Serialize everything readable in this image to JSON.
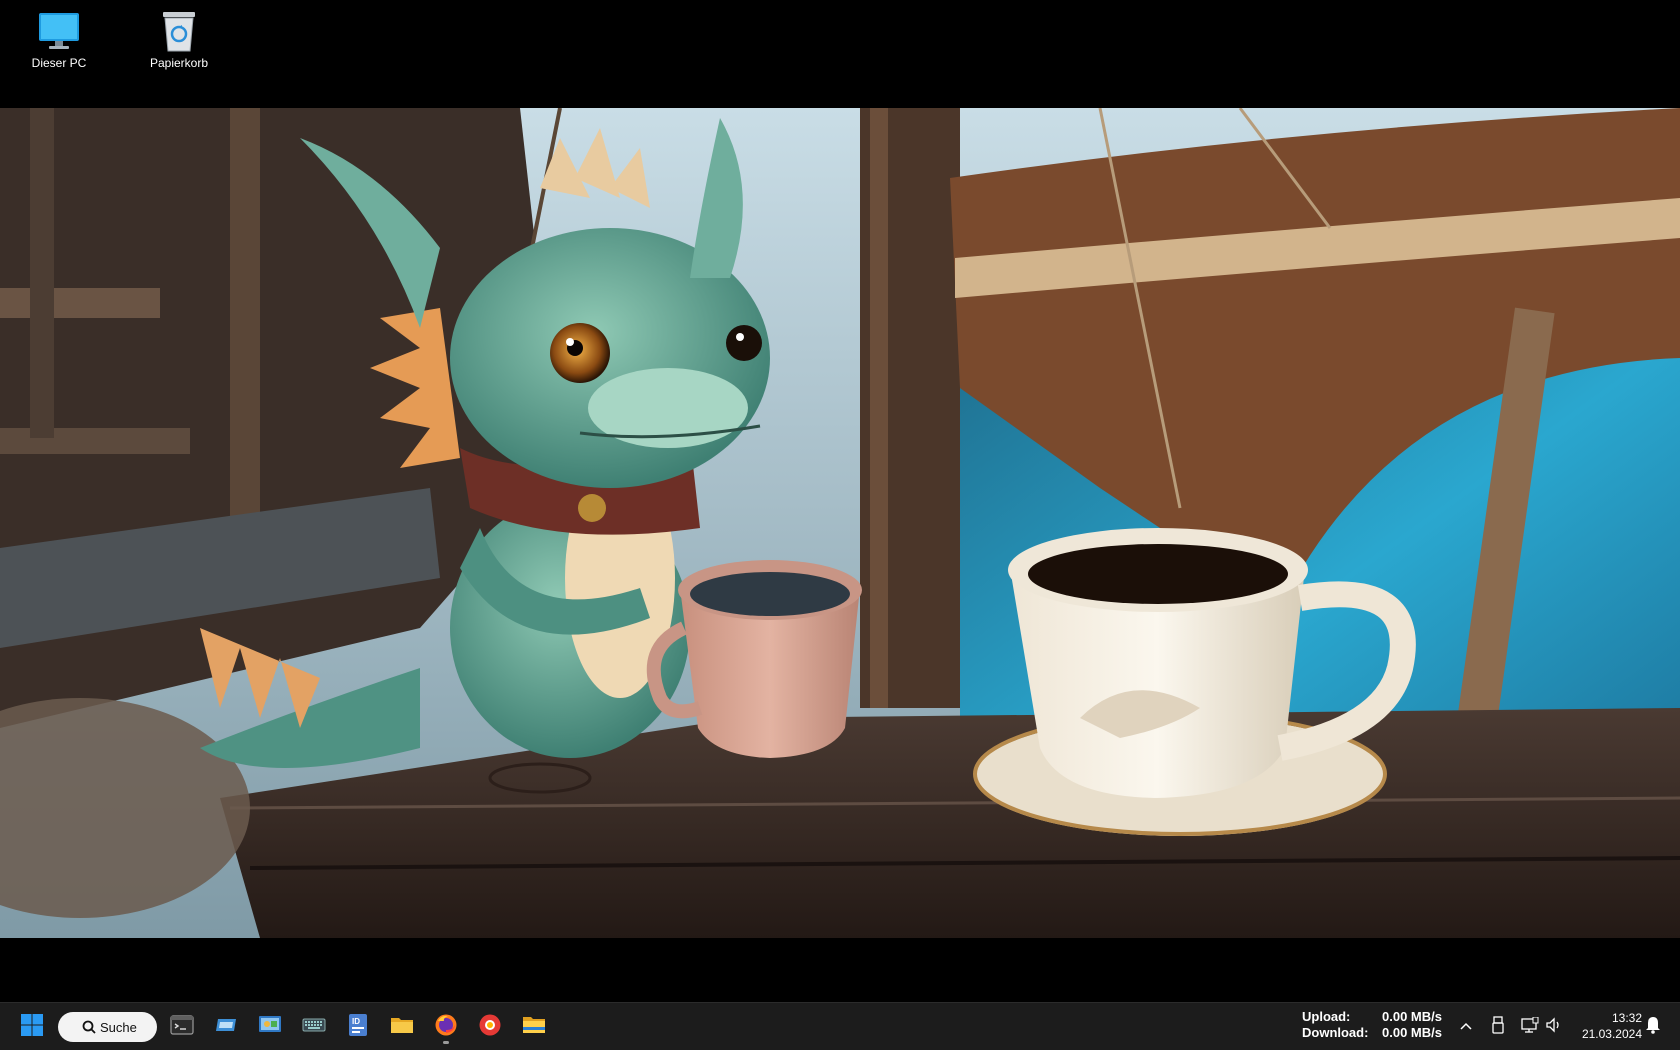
{
  "desktop": {
    "icons": [
      {
        "label": "Dieser PC",
        "icon": "computer-icon"
      },
      {
        "label": "Papierkorb",
        "icon": "recycle-bin-icon"
      }
    ],
    "wallpaper": "dragon-with-coffee-on-ship-deck"
  },
  "taskbar": {
    "start_icon": "windows-start-icon",
    "search_placeholder": "Suche",
    "apps": [
      {
        "name": "terminal",
        "icon": "terminal-icon"
      },
      {
        "name": "tablet-mode",
        "icon": "window-icon"
      },
      {
        "name": "control-panel",
        "icon": "control-panel-icon"
      },
      {
        "name": "on-screen-keyboard",
        "icon": "keyboard-icon"
      },
      {
        "name": "id-card-app",
        "icon": "id-card-icon"
      },
      {
        "name": "folder",
        "icon": "folder-icon"
      },
      {
        "name": "firefox",
        "icon": "firefox-icon",
        "active": true
      },
      {
        "name": "record-app",
        "icon": "record-icon"
      },
      {
        "name": "file-explorer",
        "icon": "file-explorer-icon"
      }
    ],
    "net": {
      "upload_label": "Upload:",
      "upload_value": "0.00 MB/s",
      "download_label": "Download:",
      "download_value": "0.00 MB/s"
    },
    "tray": [
      {
        "icon": "chevron-up-icon"
      },
      {
        "icon": "usb-drive-icon"
      },
      {
        "icon": "network-monitor-icon"
      },
      {
        "icon": "speaker-icon"
      },
      {
        "icon": "notification-bell-icon"
      }
    ],
    "clock": {
      "time": "13:32",
      "date": "21.03.2024"
    }
  }
}
